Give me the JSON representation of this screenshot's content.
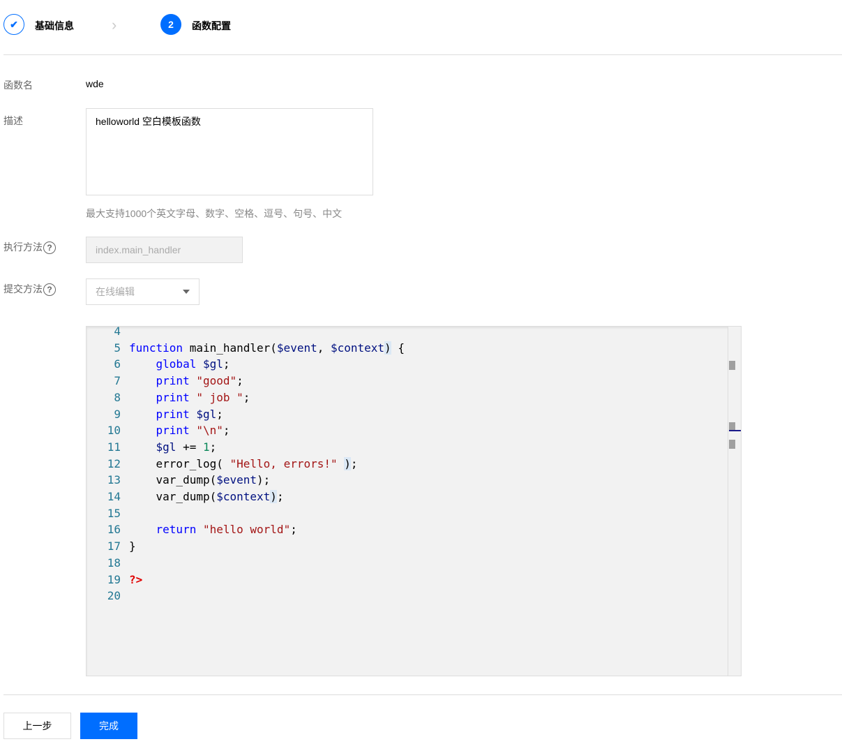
{
  "steps": [
    {
      "label": "基础信息",
      "state": "done"
    },
    {
      "label": "函数配置",
      "number": "2",
      "state": "active"
    }
  ],
  "form": {
    "name_label": "函数名",
    "name_value": "wde",
    "desc_label": "描述",
    "desc_value": "helloworld 空白模板函数",
    "desc_hint": "最大支持1000个英文字母、数字、空格、逗号、句号、中文",
    "handler_label": "执行方法",
    "handler_placeholder": "index.main_handler",
    "submit_label": "提交方法",
    "submit_value": "在线编辑"
  },
  "editor": {
    "lines": [
      {
        "n": "4",
        "t": []
      },
      {
        "n": "5",
        "t": [
          [
            "kw",
            "function"
          ],
          [
            "pl",
            " main_handler("
          ],
          [
            "var",
            "$event"
          ],
          [
            "pl",
            ", "
          ],
          [
            "var",
            "$context"
          ],
          [
            "pl br",
            ")"
          ],
          [
            "pl",
            " {"
          ]
        ]
      },
      {
        "n": "6",
        "t": [
          [
            "pl",
            "    "
          ],
          [
            "kw",
            "global"
          ],
          [
            "pl",
            " "
          ],
          [
            "var",
            "$gl"
          ],
          [
            "pl",
            ";"
          ]
        ]
      },
      {
        "n": "7",
        "t": [
          [
            "pl",
            "    "
          ],
          [
            "kw",
            "print"
          ],
          [
            "pl",
            " "
          ],
          [
            "str",
            "\"good\""
          ],
          [
            "pl",
            ";"
          ]
        ]
      },
      {
        "n": "8",
        "t": [
          [
            "pl",
            "    "
          ],
          [
            "kw",
            "print"
          ],
          [
            "pl",
            " "
          ],
          [
            "str",
            "\" job \""
          ],
          [
            "pl",
            ";"
          ]
        ]
      },
      {
        "n": "9",
        "t": [
          [
            "pl",
            "    "
          ],
          [
            "kw",
            "print"
          ],
          [
            "pl",
            " "
          ],
          [
            "var",
            "$gl"
          ],
          [
            "pl",
            ";"
          ]
        ]
      },
      {
        "n": "10",
        "t": [
          [
            "pl",
            "    "
          ],
          [
            "kw",
            "print"
          ],
          [
            "pl",
            " "
          ],
          [
            "str",
            "\"\\n\""
          ],
          [
            "pl",
            ";"
          ]
        ]
      },
      {
        "n": "11",
        "t": [
          [
            "pl",
            "    "
          ],
          [
            "var",
            "$gl"
          ],
          [
            "pl",
            " += "
          ],
          [
            "num",
            "1"
          ],
          [
            "pl",
            ";"
          ]
        ]
      },
      {
        "n": "12",
        "t": [
          [
            "pl",
            "    error_log( "
          ],
          [
            "str",
            "\"Hello, errors!\""
          ],
          [
            "pl",
            " "
          ],
          [
            "pl br",
            ")"
          ],
          [
            "pl",
            ";"
          ]
        ]
      },
      {
        "n": "13",
        "t": [
          [
            "pl",
            "    var_dump("
          ],
          [
            "var",
            "$event"
          ],
          [
            "pl",
            ");"
          ]
        ]
      },
      {
        "n": "14",
        "t": [
          [
            "pl",
            "    var_dump("
          ],
          [
            "var",
            "$context"
          ],
          [
            "pl br",
            ")"
          ],
          [
            "pl",
            ";"
          ]
        ]
      },
      {
        "n": "15",
        "t": []
      },
      {
        "n": "16",
        "t": [
          [
            "pl",
            "    "
          ],
          [
            "kw",
            "return"
          ],
          [
            "pl",
            " "
          ],
          [
            "str",
            "\"hello world\""
          ],
          [
            "pl",
            ";"
          ]
        ]
      },
      {
        "n": "17",
        "t": [
          [
            "pl",
            "}"
          ]
        ]
      },
      {
        "n": "18",
        "t": []
      },
      {
        "n": "19",
        "t": [
          [
            "php",
            "?>"
          ]
        ]
      },
      {
        "n": "20",
        "t": []
      }
    ]
  },
  "footer": {
    "prev_label": "上一步",
    "finish_label": "完成"
  },
  "colors": {
    "accent": "#006eff"
  }
}
